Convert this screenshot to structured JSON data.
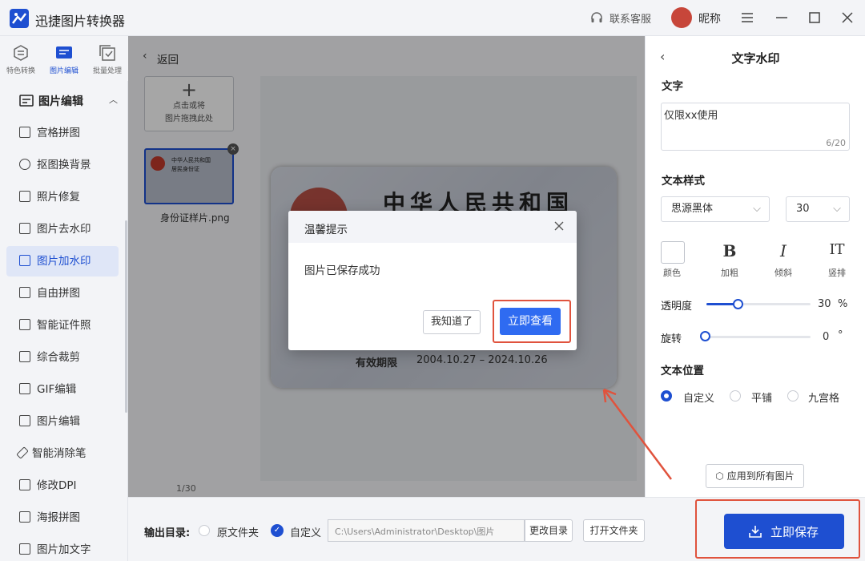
{
  "app": {
    "title": "迅捷图片转换器",
    "service": "联系客服",
    "user": "昵称"
  },
  "left_tabs": [
    {
      "label": "特色转换",
      "icon": "convert-icon"
    },
    {
      "label": "图片编辑",
      "icon": "image-edit-icon"
    },
    {
      "label": "批量处理",
      "icon": "batch-icon"
    }
  ],
  "sidebar": {
    "section": "图片编辑",
    "items": [
      {
        "label": "宫格拼图"
      },
      {
        "label": "抠图换背景"
      },
      {
        "label": "照片修复"
      },
      {
        "label": "图片去水印"
      },
      {
        "label": "图片加水印"
      },
      {
        "label": "自由拼图"
      },
      {
        "label": "智能证件照"
      },
      {
        "label": "综合裁剪"
      },
      {
        "label": "GIF编辑"
      },
      {
        "label": "图片编辑"
      },
      {
        "label": "智能消除笔"
      },
      {
        "label": "修改DPI"
      },
      {
        "label": "海报拼图"
      },
      {
        "label": "图片加文字"
      }
    ]
  },
  "main": {
    "back_label": "返回",
    "upload_line1": "点击或将",
    "upload_line2": "图片拖拽此处",
    "file_name": "身份证样片.png",
    "page_counter": "1/30"
  },
  "card": {
    "title": "中华人民共和国",
    "thumb_title": "中华人民共和国",
    "thumb_sub": "居民身份证",
    "expiry_label": "有效期限",
    "expiry_value": "2004.10.27 – 2024.10.26"
  },
  "right_panel": {
    "title": "文字水印",
    "text_label": "文字",
    "text_value": "仅限xx使用",
    "char_count": "6/20",
    "style_label": "文本样式",
    "font": "思源黑体",
    "size": "30",
    "styles": [
      {
        "label": "颜色",
        "icon": "color-swatch-icon"
      },
      {
        "label": "加粗",
        "glyph": "B",
        "icon": "bold-icon"
      },
      {
        "label": "倾斜",
        "glyph": "I",
        "icon": "italic-icon"
      },
      {
        "label": "竖排",
        "glyph": "IT",
        "icon": "vertical-text-icon"
      }
    ],
    "opacity_label": "透明度",
    "opacity_value": "30",
    "opacity_unit": "%",
    "opacity_fraction": 0.3,
    "rotation_label": "旋转",
    "rotation_value": "0",
    "rotation_unit": "°",
    "position_label": "文本位置",
    "positions": [
      "自定义",
      "平铺",
      "九宫格"
    ],
    "selected_position": "自定义",
    "apply_all": "应用到所有图片"
  },
  "bottom": {
    "output_label": "输出目录:",
    "opt_original": "原文件夹",
    "opt_custom": "自定义",
    "path": "C:\\Users\\Administrator\\Desktop\\图片",
    "change_dir": "更改目录",
    "open_folder": "打开文件夹",
    "save_now": "立即保存"
  },
  "dialog": {
    "title": "温馨提示",
    "message": "图片已保存成功",
    "btn_ok": "我知道了",
    "btn_view": "立即查看"
  },
  "colors": {
    "accent": "#1e4fd1",
    "highlight": "#e0533d"
  }
}
